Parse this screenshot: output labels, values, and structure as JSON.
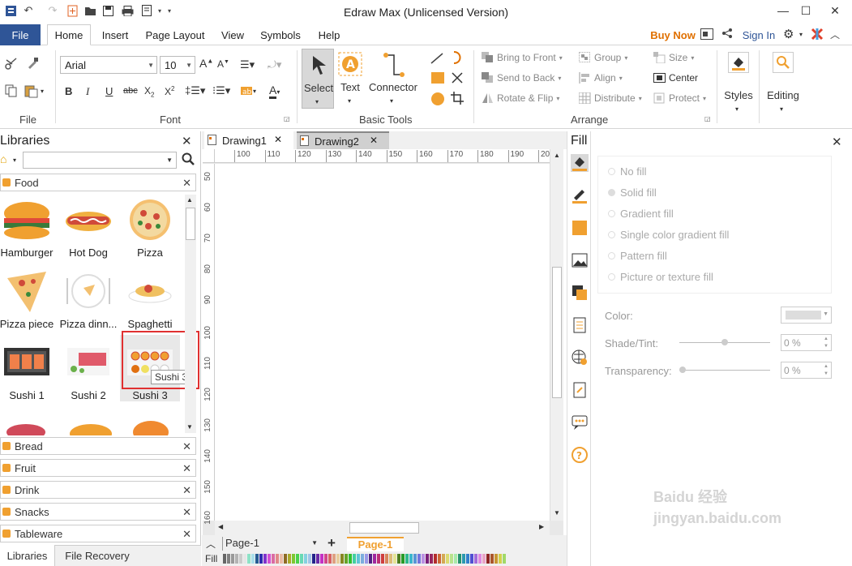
{
  "app": {
    "title": "Edraw Max (Unlicensed Version)"
  },
  "menu": {
    "file": "File",
    "tabs": [
      "Home",
      "Insert",
      "Page Layout",
      "View",
      "Symbols",
      "Help"
    ],
    "buy_now": "Buy Now",
    "sign_in": "Sign In"
  },
  "ribbon": {
    "groups": {
      "file": "File",
      "font": "Font",
      "basic_tools": "Basic Tools",
      "arrange": "Arrange"
    },
    "font_name": "Arial",
    "font_size": "10",
    "select": "Select",
    "text": "Text",
    "connector": "Connector",
    "bring_to_front": "Bring to Front",
    "send_to_back": "Send to Back",
    "rotate_flip": "Rotate & Flip",
    "group": "Group",
    "align": "Align",
    "distribute": "Distribute",
    "size": "Size",
    "center": "Center",
    "protect": "Protect",
    "styles": "Styles",
    "editing": "Editing"
  },
  "libraries": {
    "title": "Libraries",
    "search_placeholder": "",
    "food_category": "Food",
    "shapes": [
      {
        "label": "Hamburger"
      },
      {
        "label": "Hot Dog"
      },
      {
        "label": "Pizza"
      },
      {
        "label": "Pizza piece"
      },
      {
        "label": "Pizza dinn..."
      },
      {
        "label": "Spaghetti"
      },
      {
        "label": "Sushi 1"
      },
      {
        "label": "Sushi 2"
      },
      {
        "label": "Sushi 3"
      }
    ],
    "tooltip": "Sushi 3",
    "categories": [
      "Bread",
      "Fruit",
      "Drink",
      "Snacks",
      "Tableware"
    ],
    "bottom_tabs": [
      "Libraries",
      "File Recovery"
    ]
  },
  "drawing": {
    "tabs": [
      "Drawing1",
      "Drawing2"
    ],
    "ruler_h": [
      "100",
      "110",
      "120",
      "130",
      "140",
      "150",
      "160",
      "170",
      "180",
      "190",
      "20"
    ],
    "ruler_v": [
      "50",
      "60",
      "70",
      "80",
      "90",
      "100",
      "110",
      "120",
      "130",
      "140",
      "150",
      "160"
    ],
    "page_select": "Page-1",
    "page_tab": "Page-1",
    "fill_label": "Fill"
  },
  "fill_panel": {
    "title": "Fill",
    "options": [
      "No fill",
      "Solid fill",
      "Gradient fill",
      "Single color gradient fill",
      "Pattern fill",
      "Picture or texture fill"
    ],
    "selected": "Solid fill",
    "color_label": "Color:",
    "shade_label": "Shade/Tint:",
    "shade_value": "0 %",
    "transparency_label": "Transparency:",
    "transparency_value": "0 %"
  },
  "watermark": "Baidu 经验 jingyan.baidu.com",
  "colors": {
    "accent": "#2f5597",
    "orange": "#f0a030",
    "highlight": "#e03030"
  }
}
